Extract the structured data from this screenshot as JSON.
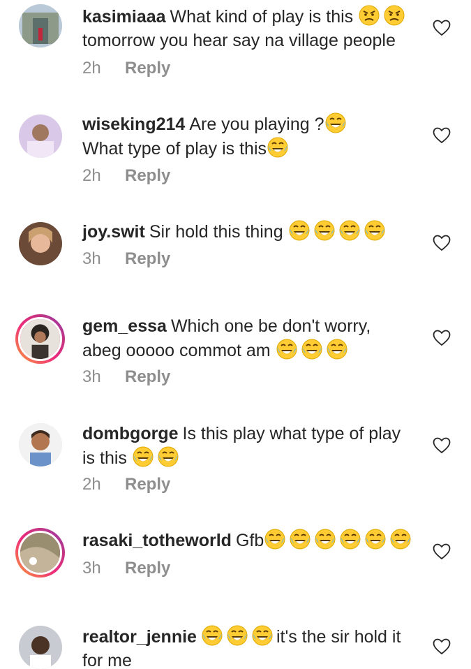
{
  "comments": [
    {
      "username": "kasimiaaa",
      "text": "What kind of play is this",
      "text2": "tomorrow you hear say na village people",
      "time": "2h",
      "reply": "Reply"
    },
    {
      "username": "wiseking214",
      "text": "Are you playing ?",
      "text2": "What type of play is this",
      "time": "2h",
      "reply": "Reply"
    },
    {
      "username": "joy.swit",
      "text": "Sir hold this thing",
      "time": "3h",
      "reply": "Reply"
    },
    {
      "username": "gem_essa",
      "text": "Which one be don't worry,",
      "text2": "abeg ooooo commot am",
      "time": "3h",
      "reply": "Reply"
    },
    {
      "username": "dombgorge",
      "text": "Is this play what type of play",
      "text2": "is this",
      "time": "2h",
      "reply": "Reply"
    },
    {
      "username": "rasaki_totheworld",
      "text": "Gfb",
      "time": "3h",
      "reply": "Reply"
    },
    {
      "username": "realtor_jennie",
      "text": "it's the sir hold it",
      "text2": "for me"
    }
  ],
  "icons": {
    "like": "heart-outline-icon",
    "laugh": "face-with-tears-of-joy-icon",
    "angry": "angry-face-icon"
  },
  "colors": {
    "text": "#262626",
    "meta": "#8e8e8e",
    "story_ring_start": "#f9a13a",
    "story_ring_end": "#8a3ab9"
  }
}
